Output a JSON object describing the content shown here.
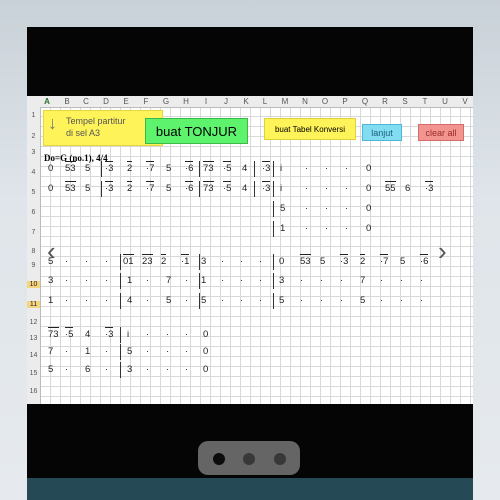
{
  "columns": [
    "A",
    "B",
    "C",
    "D",
    "E",
    "F",
    "G",
    "H",
    "I",
    "J",
    "K",
    "L",
    "M",
    "N",
    "O",
    "P",
    "Q",
    "R",
    "S",
    "T",
    "U",
    "V"
  ],
  "selected_column": "A",
  "rows": [
    "1",
    "2",
    "3",
    "4",
    "5",
    "6",
    "7",
    "8",
    "9",
    "10",
    "11",
    "12",
    "13",
    "14",
    "15",
    "16"
  ],
  "selected_rows": [
    "10",
    "11"
  ],
  "note": {
    "line1": "Tempel partitur",
    "line2": "di sel A3"
  },
  "buttons": {
    "buat_tonjur": "buat TONJUR",
    "buat_tabel": "buat Tabel Konversi",
    "lanjut": "lanjut",
    "clear_all": "clear all"
  },
  "colors": {
    "note": "#fff35a",
    "tonjur": "#5ef36c",
    "tabel": "#fff35a",
    "lanjut": "#82ddf3",
    "clear": "#f29590",
    "frame": "#050505",
    "footer": "#254a55"
  },
  "key_signature": "Do=G (no.1), 4/4",
  "notes": {
    "r4": [
      "0",
      "53",
      "5",
      "·3",
      "2",
      "·7",
      "5",
      "·6",
      "73",
      "·5",
      "4",
      "·3",
      "i",
      "·",
      "·",
      "·",
      "0"
    ],
    "r5": [
      "0",
      "53",
      "5",
      "·3",
      "2",
      "·7",
      "5",
      "·6",
      "73",
      "·5",
      "4",
      "·3",
      "i",
      "·",
      "·",
      "·",
      "0",
      "55",
      "6",
      "·3"
    ],
    "r6": [
      "5",
      "·",
      "·",
      "·",
      "0"
    ],
    "r7": [
      "1",
      "·",
      "·",
      "·",
      "0"
    ],
    "r9": [
      "5",
      "·",
      "·",
      "·",
      "01",
      "23",
      "2",
      "·1",
      "3",
      "·",
      "·",
      "·",
      "0",
      "53",
      "5",
      "·3",
      "2",
      "·7",
      "5",
      "·6"
    ],
    "r10": [
      "3",
      "·",
      "·",
      "·",
      "1",
      "·",
      "7",
      "·",
      "1",
      "·",
      "·",
      "·",
      "3",
      "·",
      "·",
      "·",
      "7",
      "·",
      "·",
      "·"
    ],
    "r11": [
      "1",
      "·",
      "·",
      "·",
      "4",
      "·",
      "5",
      "·",
      "5",
      "·",
      "·",
      "·",
      "5",
      "·",
      "·",
      "·",
      "5",
      "·",
      "·",
      "·"
    ],
    "r13": [
      "73",
      "·5",
      "4",
      "·3",
      "i",
      "·",
      "·",
      "·",
      "0"
    ],
    "r14": [
      "7",
      "·",
      "1",
      "·",
      "5",
      "·",
      "·",
      "·",
      "0"
    ],
    "r15": [
      "5",
      "·",
      "6",
      "·",
      "3",
      "·",
      "·",
      "·",
      "0"
    ]
  },
  "nav": {
    "prev": "‹",
    "next": "›"
  },
  "pager": {
    "count": 3,
    "active": 0
  }
}
